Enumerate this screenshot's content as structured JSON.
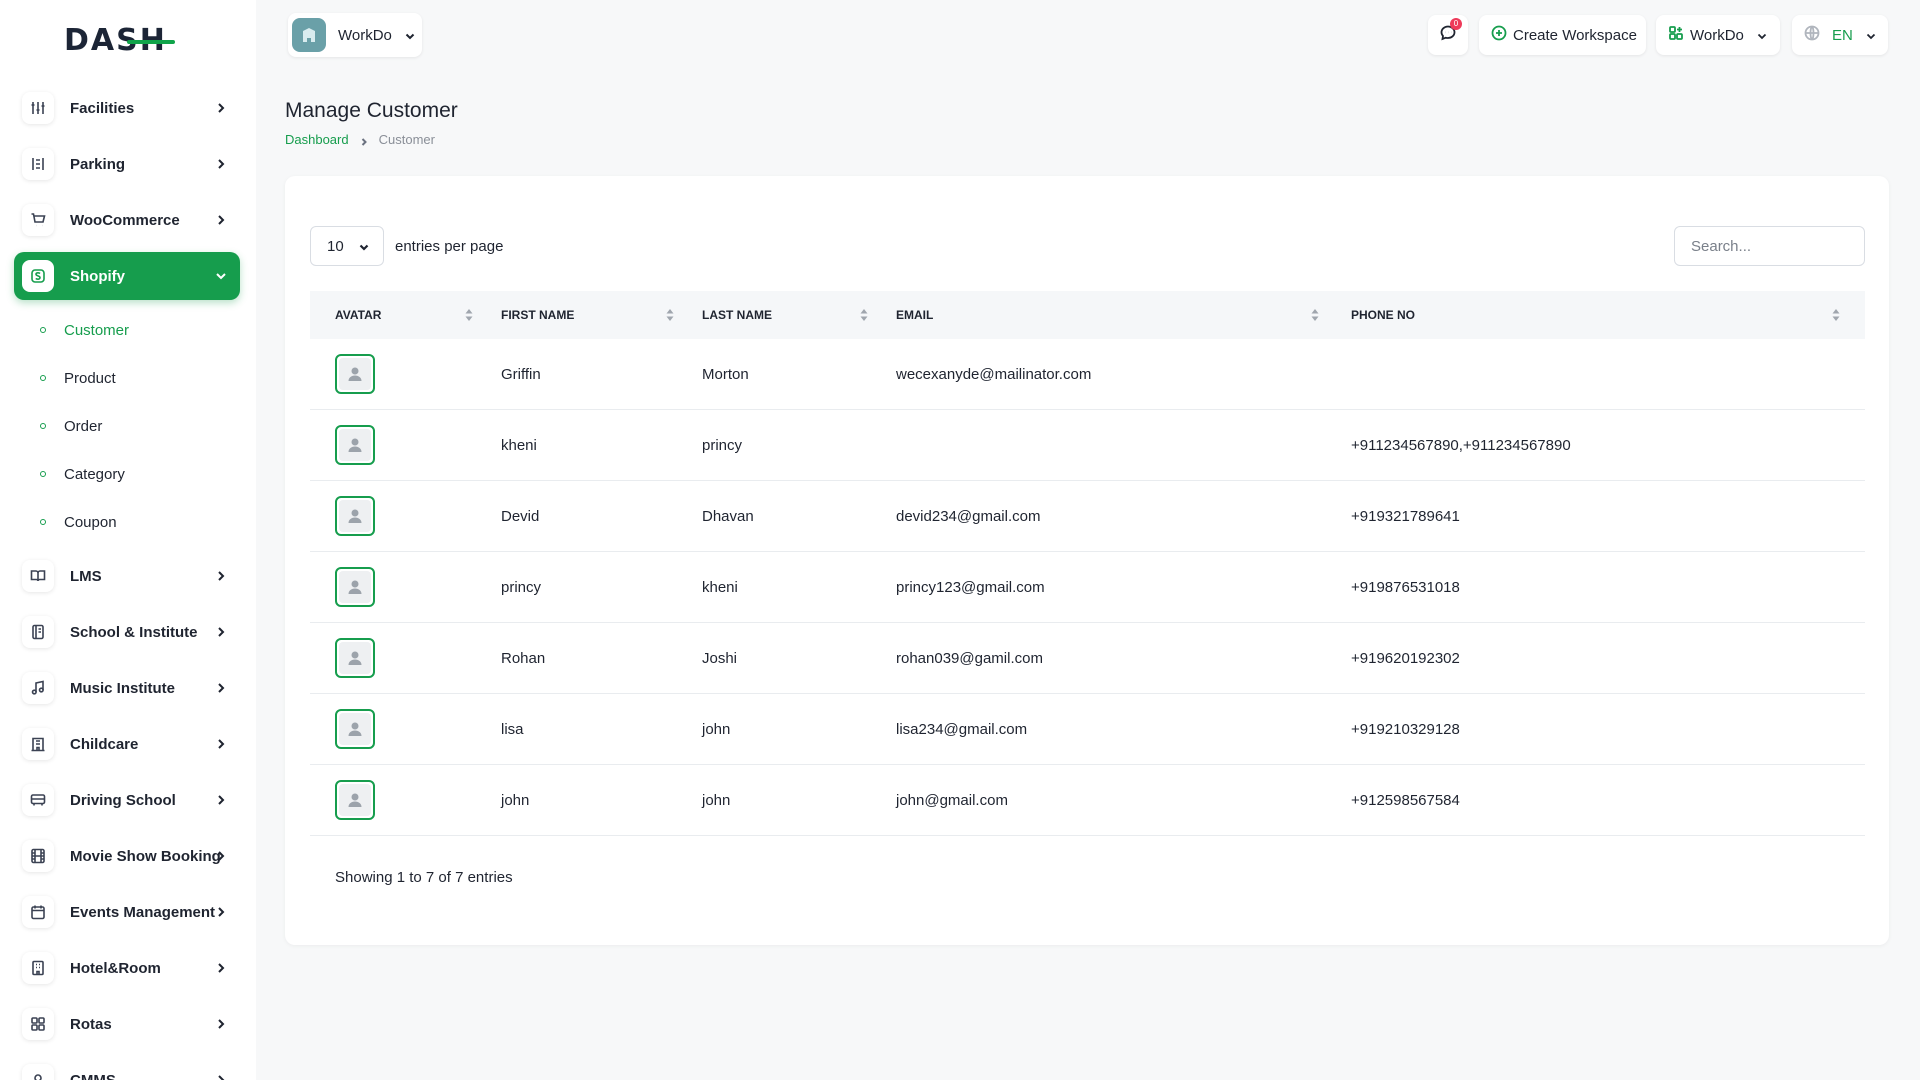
{
  "logo": {
    "text": "DASH"
  },
  "sidebar": {
    "items_top": [
      {
        "label": "Facilities",
        "icon": "sliders-icon"
      },
      {
        "label": "Parking",
        "icon": "parking-icon"
      },
      {
        "label": "WooCommerce",
        "icon": "cart-icon"
      }
    ],
    "active": {
      "label": "Shopify",
      "icon": "shopify-icon"
    },
    "sub_items": [
      "Customer",
      "Product",
      "Order",
      "Category",
      "Coupon"
    ],
    "items_bottom": [
      {
        "label": "LMS",
        "icon": "book-icon"
      },
      {
        "label": "School & Institute",
        "icon": "notebook-icon"
      },
      {
        "label": "Music Institute",
        "icon": "music-icon"
      },
      {
        "label": "Childcare",
        "icon": "building-icon"
      },
      {
        "label": "Driving School",
        "icon": "bus-icon"
      },
      {
        "label": "Movie Show Booking",
        "icon": "film-icon"
      },
      {
        "label": "Events Management",
        "icon": "calendar-icon"
      },
      {
        "label": "Hotel&Room",
        "icon": "hotel-icon"
      },
      {
        "label": "Rotas",
        "icon": "grid-icon"
      },
      {
        "label": "CMMS",
        "icon": "wrench-icon"
      }
    ]
  },
  "topbar": {
    "workspace_name": "WorkDo",
    "message_count": "0",
    "create_workspace": "Create Workspace",
    "workspace_menu": "WorkDo",
    "language": "EN"
  },
  "page": {
    "title": "Manage Customer",
    "breadcrumb": {
      "home": "Dashboard",
      "current": "Customer"
    }
  },
  "table": {
    "per_page_value": "10",
    "per_page_label": "entries per page",
    "search_placeholder": "Search...",
    "headers": {
      "avatar": "AVATAR",
      "first_name": "FIRST NAME",
      "last_name": "LAST NAME",
      "email": "EMAIL",
      "phone": "PHONE NO"
    },
    "rows": [
      {
        "first_name": "Griffin",
        "last_name": "Morton",
        "email": "wecexanyde@mailinator.com",
        "phone": ""
      },
      {
        "first_name": "kheni",
        "last_name": "princy",
        "email": "",
        "phone": "+911234567890,+911234567890"
      },
      {
        "first_name": "Devid",
        "last_name": "Dhavan",
        "email": "devid234@gmail.com",
        "phone": "+919321789641"
      },
      {
        "first_name": "princy",
        "last_name": "kheni",
        "email": "princy123@gmail.com",
        "phone": "+919876531018"
      },
      {
        "first_name": "Rohan",
        "last_name": "Joshi",
        "email": "rohan039@gamil.com",
        "phone": "+919620192302"
      },
      {
        "first_name": "lisa",
        "last_name": "john",
        "email": "lisa234@gmail.com",
        "phone": "+919210329128"
      },
      {
        "first_name": "john",
        "last_name": "john",
        "email": "john@gmail.com",
        "phone": "+912598567584"
      }
    ],
    "footer": "Showing 1 to 7 of 7 entries"
  },
  "colors": {
    "accent": "#169d4d",
    "badge": "#ee3a5a"
  }
}
